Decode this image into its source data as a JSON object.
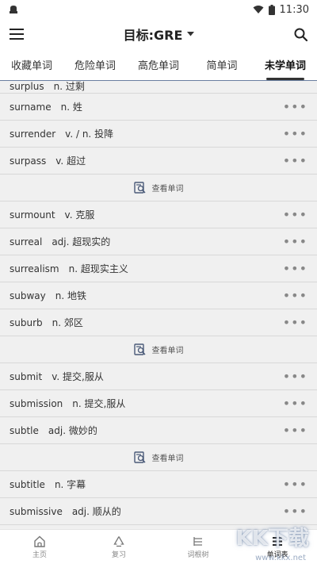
{
  "status_bar": {
    "time": "11:30"
  },
  "app_bar": {
    "title": "目标:GRE"
  },
  "tabs": [
    {
      "label": "收藏单词",
      "active": false
    },
    {
      "label": "危险单词",
      "active": false
    },
    {
      "label": "高危单词",
      "active": false
    },
    {
      "label": "简单词",
      "active": false
    },
    {
      "label": "未学单词",
      "active": true
    }
  ],
  "list": {
    "partial": {
      "word": "surplus",
      "def": "n. 过剩"
    },
    "rows": [
      {
        "word": "surname",
        "def": "n. 姓"
      },
      {
        "word": "surrender",
        "def": "v. / n. 投降"
      },
      {
        "word": "surpass",
        "def": "v. 超过"
      },
      {
        "word": "surmount",
        "def": "v. 克服"
      },
      {
        "word": "surreal",
        "def": "adj. 超现实的"
      },
      {
        "word": "surrealism",
        "def": "n. 超现实主义"
      },
      {
        "word": "subway",
        "def": "n. 地铁"
      },
      {
        "word": "suburb",
        "def": "n. 郊区"
      },
      {
        "word": "submit",
        "def": "v. 提交,服从"
      },
      {
        "word": "submission",
        "def": "n. 提交,服从"
      },
      {
        "word": "subtle",
        "def": "adj. 微妙的"
      },
      {
        "word": "subtitle",
        "def": "n. 字幕"
      },
      {
        "word": "submissive",
        "def": "adj. 顺从的"
      }
    ],
    "more_glyph": "•••",
    "lookup_label": "查看单词"
  },
  "bottom_nav": [
    {
      "label": "主页",
      "icon": "home-icon"
    },
    {
      "label": "复习",
      "icon": "recycle-icon"
    },
    {
      "label": "词根树",
      "icon": "tree-icon"
    },
    {
      "label": "单词表",
      "icon": "list-icon"
    }
  ],
  "watermark": {
    "text": "KK下载",
    "url": "www.kkx.net"
  },
  "colors": {
    "accent": "#6a7fa0",
    "list_bg": "#f0f0f0",
    "divider": "#d8d8d8"
  }
}
